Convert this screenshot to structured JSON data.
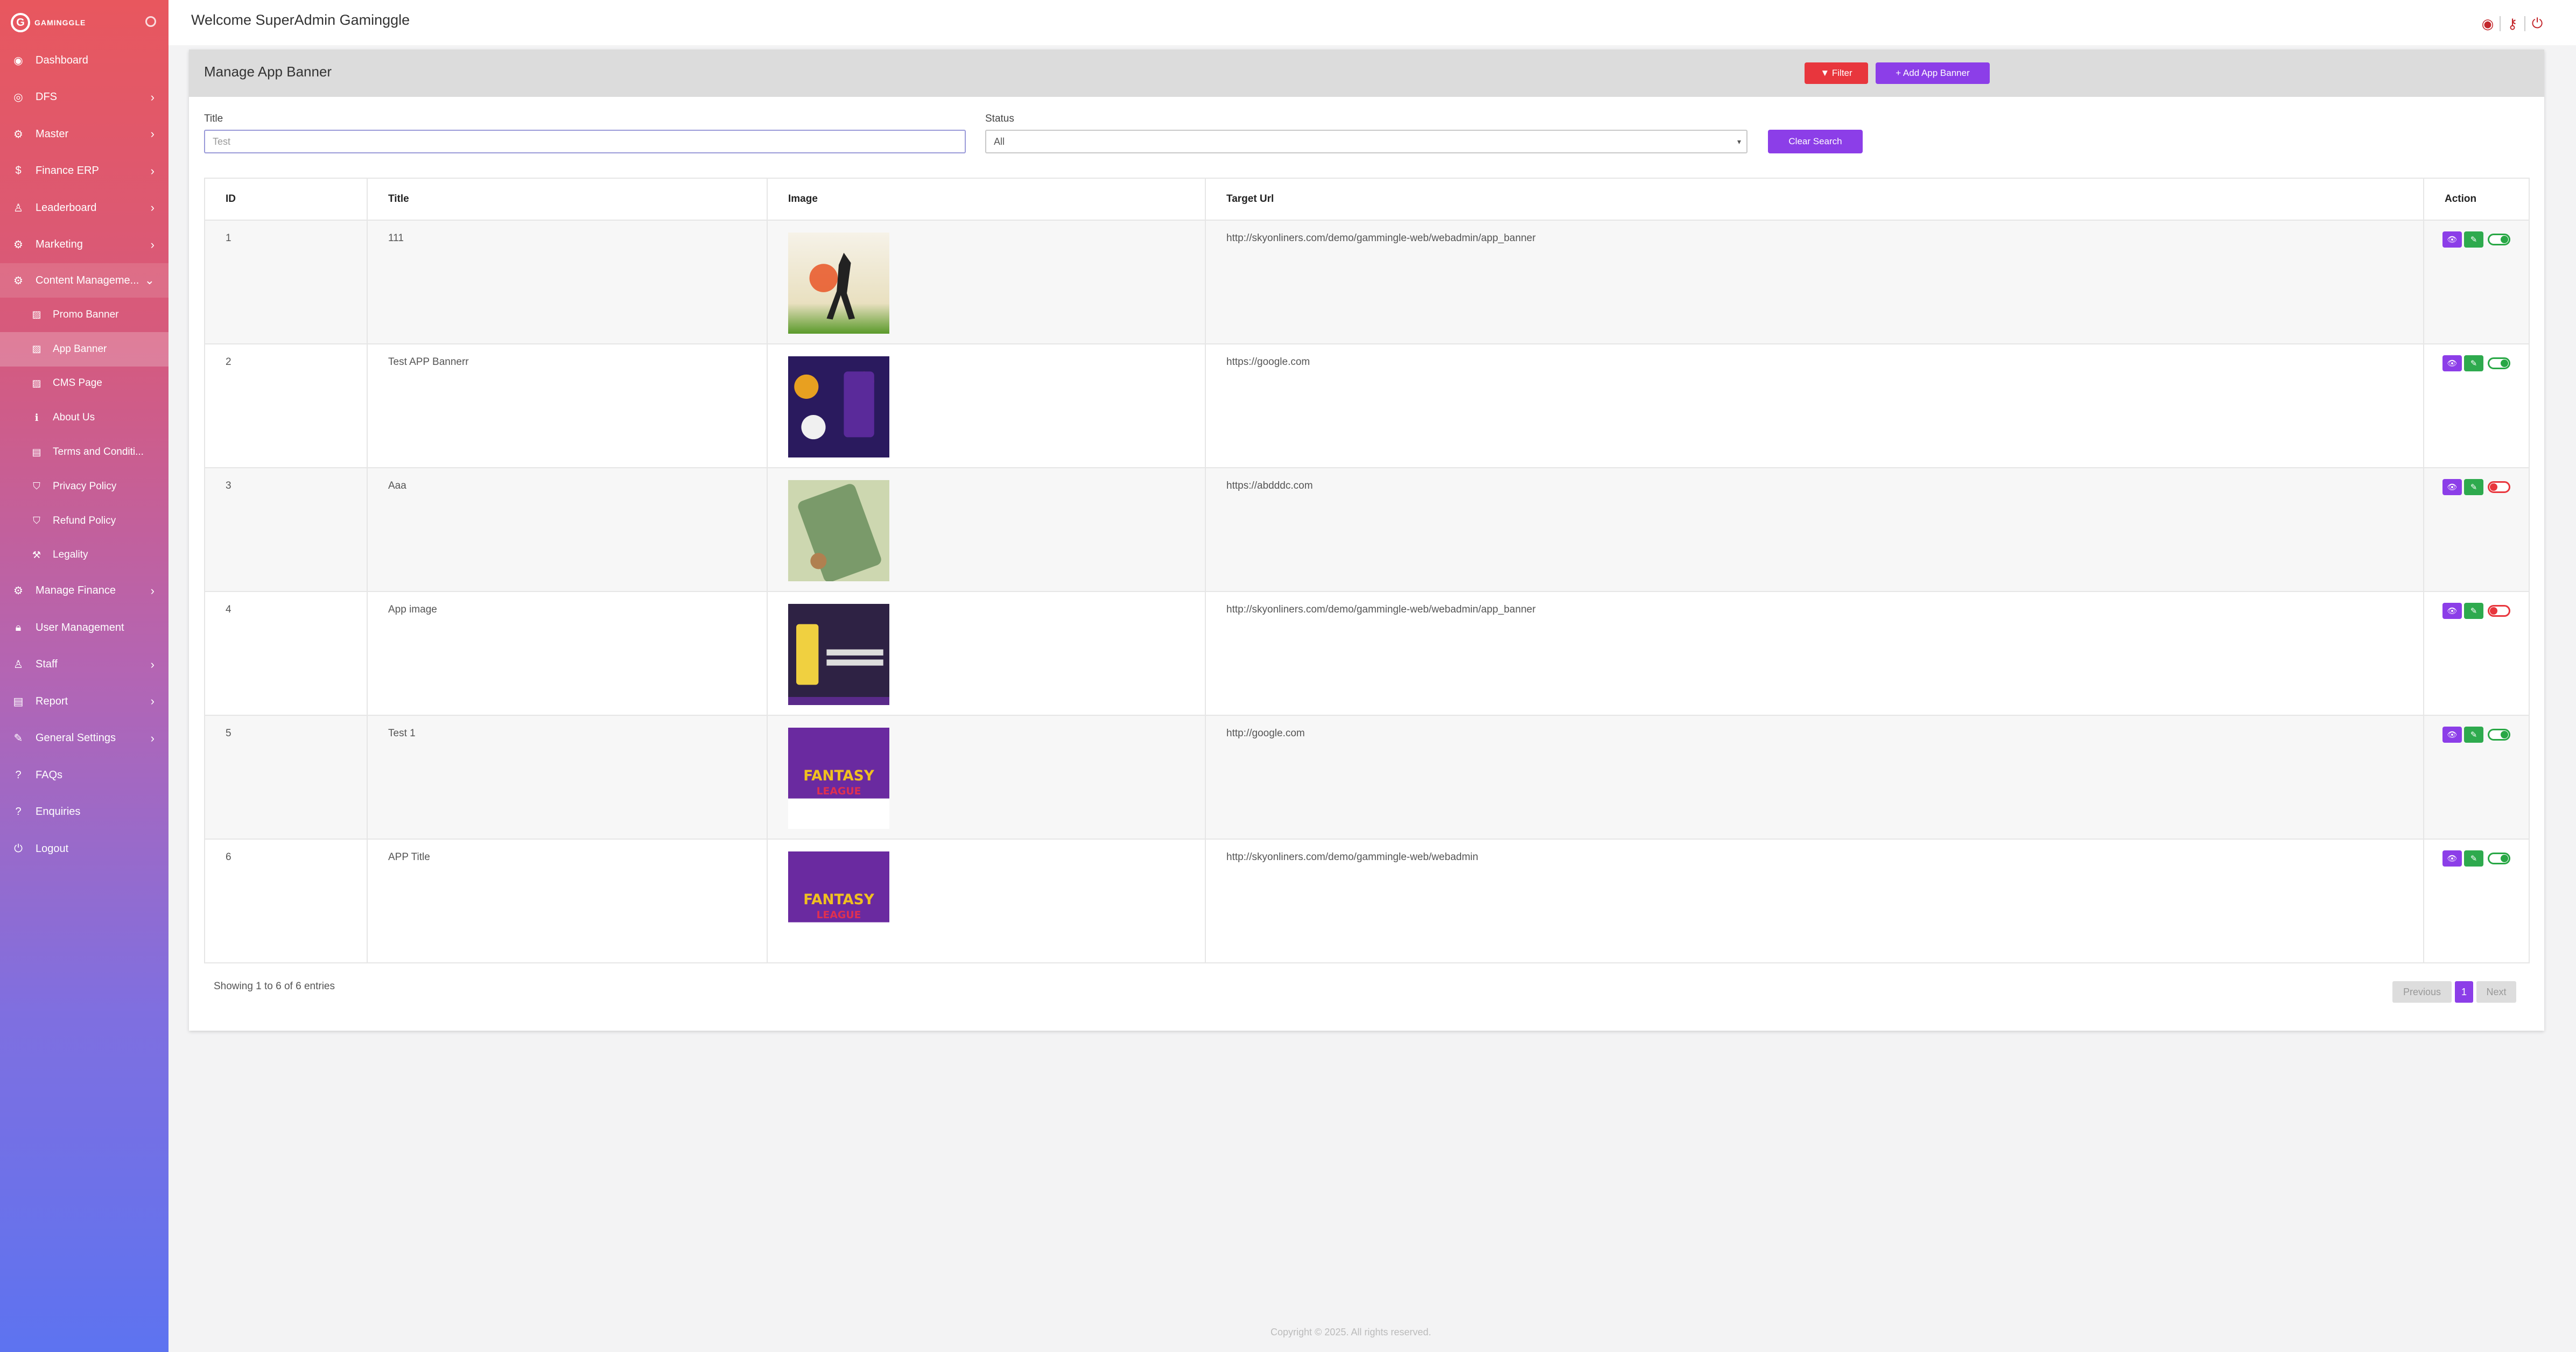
{
  "brand": {
    "logo_letter": "G",
    "name": "GAMINGGLE"
  },
  "header": {
    "welcome": "Welcome SuperAdmin Gaminggle"
  },
  "sidebar": {
    "items": [
      {
        "label": "Dashboard",
        "icon": "palette-icon"
      },
      {
        "label": "DFS",
        "icon": "target-icon"
      },
      {
        "label": "Master",
        "icon": "gears-icon"
      },
      {
        "label": "Finance ERP",
        "icon": "dollar-icon"
      },
      {
        "label": "Leaderboard",
        "icon": "user-icon"
      },
      {
        "label": "Marketing",
        "icon": "gears-icon"
      },
      {
        "label": "Content Manageme...",
        "icon": "gears-icon"
      }
    ],
    "subitems": [
      {
        "label": "Promo Banner",
        "icon": "image-icon"
      },
      {
        "label": "App Banner",
        "icon": "image-icon"
      },
      {
        "label": "CMS Page",
        "icon": "image-icon"
      },
      {
        "label": "About Us",
        "icon": "info-icon"
      },
      {
        "label": "Terms and Conditi...",
        "icon": "document-icon"
      },
      {
        "label": "Privacy Policy",
        "icon": "shield-icon"
      },
      {
        "label": "Refund Policy",
        "icon": "shield-icon"
      },
      {
        "label": "Legality",
        "icon": "gavel-icon"
      }
    ],
    "items2": [
      {
        "label": "Manage Finance",
        "icon": "gears-icon"
      },
      {
        "label": "User Management",
        "icon": "lock-icon"
      },
      {
        "label": "Staff",
        "icon": "user-icon"
      },
      {
        "label": "Report",
        "icon": "document-icon"
      },
      {
        "label": "General Settings",
        "icon": "wrench-icon"
      },
      {
        "label": "FAQs",
        "icon": "question-icon"
      },
      {
        "label": "Enquiries",
        "icon": "question-icon"
      },
      {
        "label": "Logout",
        "icon": "power-icon"
      }
    ]
  },
  "page": {
    "title": "Manage App Banner",
    "filter_label": "▼ Filter",
    "add_label": "+ Add App Banner"
  },
  "filters": {
    "title_label": "Title",
    "title_value": "Test",
    "status_label": "Status",
    "status_value": "All",
    "clear_label": "Clear Search"
  },
  "table": {
    "headers": [
      "ID",
      "Title",
      "Image",
      "Target Url",
      "Action"
    ],
    "rows": [
      {
        "id": "1",
        "title": "111",
        "url": "http://skyonliners.com/demo/gammingle-web/webadmin/app_banner",
        "status": "on"
      },
      {
        "id": "2",
        "title": "Test APP Bannerr",
        "url": "https://google.com",
        "status": "on"
      },
      {
        "id": "3",
        "title": "Aaa",
        "url": "https://abdddc.com",
        "status": "off"
      },
      {
        "id": "4",
        "title": "App image",
        "url": "http://skyonliners.com/demo/gammingle-web/webadmin/app_banner",
        "status": "off"
      },
      {
        "id": "5",
        "title": "Test 1",
        "url": "http://google.com",
        "status": "on"
      },
      {
        "id": "6",
        "title": "APP Title",
        "url": "http://skyonliners.com/demo/gammingle-web/webadmin",
        "status": "on"
      }
    ]
  },
  "pagination": {
    "showing": "Showing 1 to 6 of 6 entries",
    "prev": "Previous",
    "page": "1",
    "next": "Next"
  },
  "footer": {
    "copyright": "Copyright © 2025. All rights reserved."
  },
  "colors": {
    "accent": "#8c3ee8",
    "danger": "#e8363d",
    "success": "#2eaa4e"
  }
}
